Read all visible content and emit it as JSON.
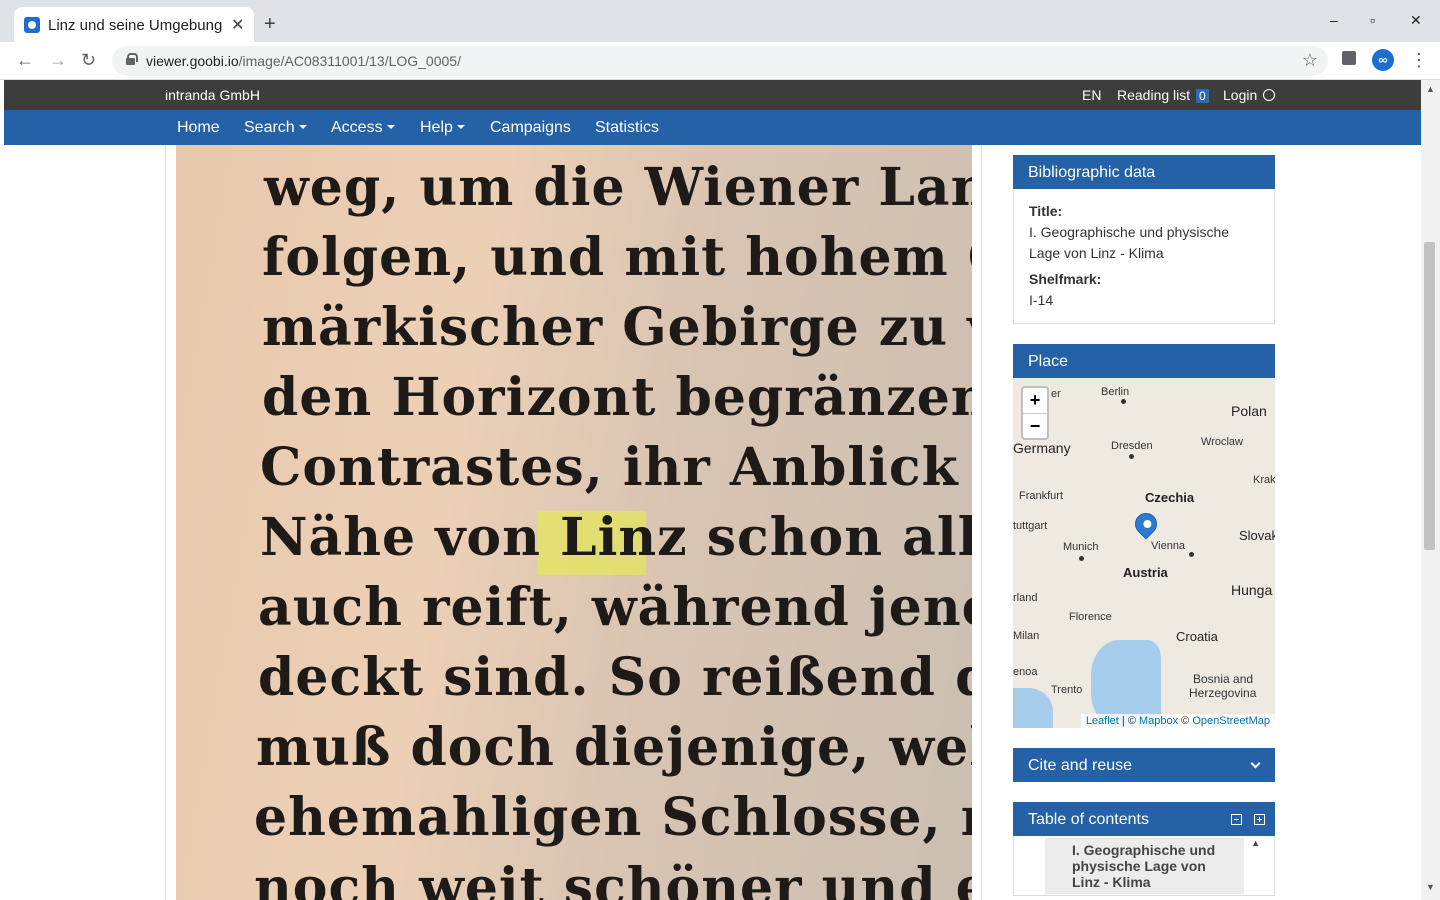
{
  "browser": {
    "tab_title": "Linz und seine Umgebung",
    "tab_close": "✕",
    "new_tab": "+",
    "url_host": "viewer.goobi.io",
    "url_path": "/image/AC08311001/13/LOG_0005/",
    "window_controls": [
      "–",
      "▫",
      "✕"
    ]
  },
  "topbar": {
    "brand": "intranda GmbH",
    "language": "EN",
    "reading_list_label": "Reading list",
    "reading_list_count": "0",
    "login_label": "Login"
  },
  "nav": {
    "items": [
      {
        "label": "Home",
        "dropdown": false
      },
      {
        "label": "Search",
        "dropdown": true
      },
      {
        "label": "Access",
        "dropdown": true
      },
      {
        "label": "Help",
        "dropdown": true
      },
      {
        "label": "Campaigns",
        "dropdown": false
      },
      {
        "label": "Statistics",
        "dropdown": false
      }
    ]
  },
  "scan": {
    "lines": [
      "weg, um die Wiener Land",
      "folgen, und mit hohem Ge",
      "märkischer Gebirge zu verw",
      "den Horizont begränzen. D",
      "Contrastes, ihr Anblick zu",
      "Nähe von Linz schon alles",
      "auch reift, während jene G",
      "deckt sind. So reißend di",
      "muß doch diejenige, welch",
      "ehemahligen Schlosse, nun",
      "noch weit schöner und erhab"
    ],
    "highlight_word": "Linz"
  },
  "bibliographic": {
    "heading": "Bibliographic data",
    "title_label": "Title:",
    "title_value": "I. Geographische und physische Lage von Linz - Klima",
    "shelfmark_label": "Shelfmark:",
    "shelfmark_value": "I-14"
  },
  "place": {
    "heading": "Place",
    "zoom_in": "+",
    "zoom_out": "−",
    "countries": [
      "Germany",
      "Polan",
      "Czechia",
      "Austria",
      "Hunga",
      "Croatia",
      "Slovak",
      "Bosnia and",
      "Herzegovina"
    ],
    "cities": [
      "Berlin",
      "Dresden",
      "Wroclaw",
      "Frankfurt",
      "Munich",
      "Vienna",
      "Milan",
      "Trento",
      "Florence",
      "Krak",
      "tuttgart",
      "rland",
      "enoa",
      "er"
    ],
    "attribution_leaflet": "Leaflet",
    "attribution_sep1": " | © ",
    "attribution_mapbox": "Mapbox",
    "attribution_sep2": " © ",
    "attribution_osm": "OpenStreetMap"
  },
  "cite": {
    "heading": "Cite and reuse"
  },
  "toc": {
    "heading": "Table of contents",
    "entry": "I. Geographische und physische Lage von Linz - Klima"
  }
}
